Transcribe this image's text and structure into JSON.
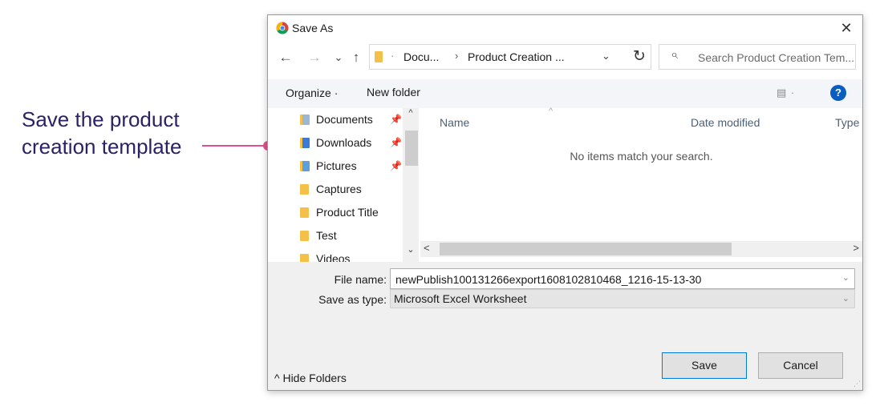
{
  "annotation": {
    "text": "Save the product creation template"
  },
  "colors": {
    "accent": "#0a5ec0",
    "annotation_text": "#2b2165",
    "callout": "#e0528f",
    "folder": "#f3c04a"
  },
  "dialog": {
    "title": "Save As",
    "close": "✕",
    "nav": {
      "back": "←",
      "forward": "→",
      "recent": "⌄",
      "up": "↑",
      "refresh": "↻"
    },
    "address": {
      "separator": "·",
      "crumb1": "Docu...",
      "chevron": "›",
      "crumb2": "Product Creation ...",
      "dropdown": "⌄"
    },
    "search": {
      "icon": "⌕",
      "placeholder": "Search Product Creation Tem..."
    },
    "toolbar": {
      "organize": "Organize ·",
      "new_folder": "New folder",
      "view": "▤ ·",
      "help": "?"
    },
    "nav_items": [
      {
        "label": "Documents",
        "pinned": true,
        "icon": "documents-folder-icon"
      },
      {
        "label": "Downloads",
        "pinned": true,
        "icon": "downloads-folder-icon"
      },
      {
        "label": "Pictures",
        "pinned": true,
        "icon": "pictures-folder-icon"
      },
      {
        "label": "Captures",
        "pinned": false,
        "icon": "folder-icon"
      },
      {
        "label": "Product Title",
        "pinned": false,
        "icon": "folder-icon"
      },
      {
        "label": "Test",
        "pinned": false,
        "icon": "folder-icon"
      },
      {
        "label": "Videos",
        "pinned": false,
        "icon": "videos-folder-icon"
      }
    ],
    "pin_glyph": "📌",
    "scroll": {
      "up": "^",
      "down": "⌄",
      "left": "<",
      "right": ">"
    },
    "columns": {
      "name": "Name",
      "date": "Date modified",
      "type": "Type",
      "sort_caret": "^"
    },
    "empty_message": "No items match your search.",
    "file_name": {
      "label": "File name:",
      "value": "newPublish100131266export1608102810468_1216-15-13-30",
      "dropdown": "⌄"
    },
    "save_as_type": {
      "label": "Save as type:",
      "value": "Microsoft Excel Worksheet",
      "dropdown": "⌄"
    },
    "hide_folders": "^ Hide Folders",
    "save": "Save",
    "cancel": "Cancel",
    "grip": "⋰"
  }
}
